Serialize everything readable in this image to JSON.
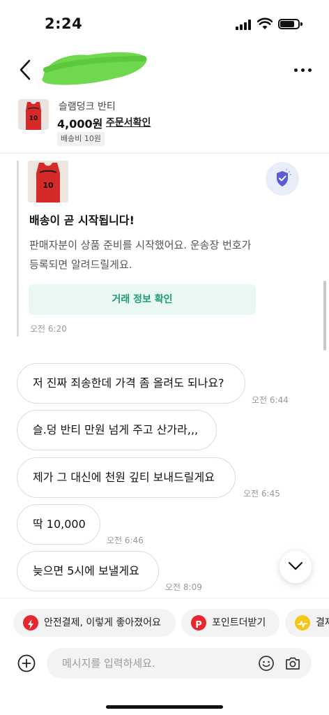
{
  "status_bar": {
    "time": "2:24"
  },
  "header": {
    "icons": [
      "back-icon",
      "more-icon"
    ]
  },
  "product": {
    "name": "슬램덩크 반티",
    "price": "4,000원",
    "order_link": "주문서확인",
    "shipping": "배송비 10원",
    "jersey_number": "10"
  },
  "system_card": {
    "title": "배송이 곧 시작됩니다!",
    "body": "판매자분이 상품 준비를 시작했어요. 운송장 번호가 등록되면 알려드릴게요.",
    "button": "거래 정보 확인",
    "time": "오전 6:20"
  },
  "messages": [
    {
      "text": "저 진짜 죄송한데 가격 좀 올려도 되나요?",
      "time": "오전 6:44"
    },
    {
      "text": "슬.덩 반티 만원 넘게 주고 산가라,,,",
      "time": ""
    },
    {
      "text": "제가 그 대신에 천원 깊티 보내드릴게요",
      "time": "오전 6:45"
    },
    {
      "text": "딱 10,000",
      "time": "오전 6:46"
    },
    {
      "text": "늦으면 5시에 보낼게요",
      "time": "오전 8:09"
    }
  ],
  "quick_replies": [
    {
      "label": "안전결제, 이렇게 좋아졌어요",
      "icon": "lightning-icon",
      "color": "#e8262f"
    },
    {
      "label": "포인트더받기",
      "icon": "points-icon",
      "color": "#e8262f"
    },
    {
      "label": "결제",
      "icon": "pay-icon",
      "color": "#f5c518"
    }
  ],
  "composer": {
    "placeholder": "메시지를 입력하세요."
  },
  "colors": {
    "accent_green": "#1f9b6d",
    "shield_purple": "#5b5bd6"
  }
}
